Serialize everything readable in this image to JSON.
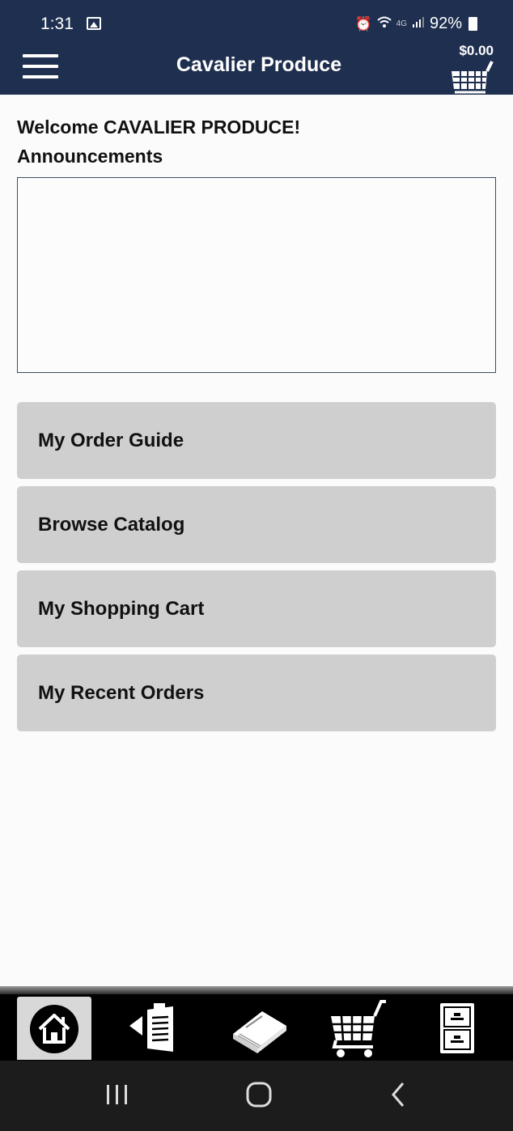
{
  "status_bar": {
    "time": "1:31",
    "battery": "92%",
    "network": "4G"
  },
  "header": {
    "title": "Cavalier Produce",
    "cart_total": "$0.00"
  },
  "content": {
    "welcome": "Welcome CAVALIER PRODUCE!",
    "announcements_label": "Announcements"
  },
  "menu": {
    "items": [
      {
        "label": "My Order Guide"
      },
      {
        "label": "Browse Catalog"
      },
      {
        "label": "My Shopping Cart"
      },
      {
        "label": "My Recent Orders"
      }
    ]
  },
  "tab_bar": {
    "tabs": [
      {
        "icon": "home-icon",
        "active": true
      },
      {
        "icon": "order-guide-icon",
        "active": false
      },
      {
        "icon": "catalog-book-icon",
        "active": false
      },
      {
        "icon": "shopping-cart-icon",
        "active": false
      },
      {
        "icon": "file-cabinet-icon",
        "active": false
      }
    ]
  },
  "system_nav": {
    "buttons": [
      "recent-apps-icon",
      "home-button-icon",
      "back-icon"
    ]
  },
  "colors": {
    "header_bg": "#1f2f4f",
    "button_bg": "#cfcfcf",
    "tab_bar_bg": "#000000",
    "active_tab_bg": "#d8d8d8"
  }
}
